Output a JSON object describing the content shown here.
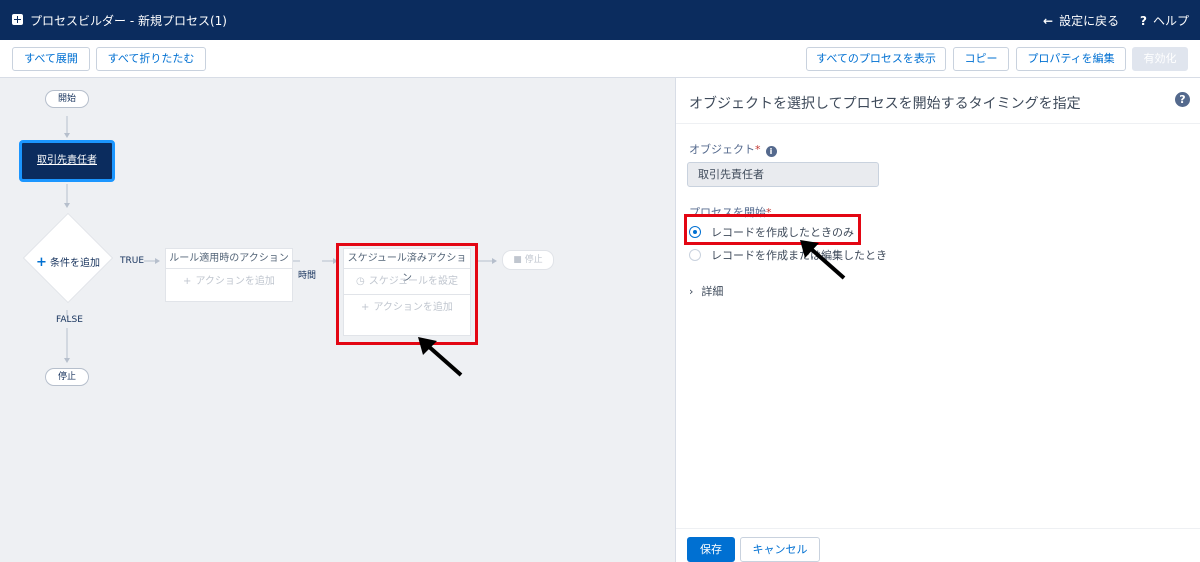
{
  "header": {
    "title": "プロセスビルダー - 新規プロセス(1)",
    "back_label": "設定に戻る",
    "help_label": "ヘルプ",
    "bg_color": "#0b2c5e"
  },
  "toolbar": {
    "expand_all": "すべて展開",
    "collapse_all": "すべて折りたたむ",
    "view_all": "すべてのプロセスを表示",
    "copy": "コピー",
    "edit_properties": "プロパティを編集",
    "activate": "有効化"
  },
  "canvas": {
    "start_label": "開始",
    "object_node": "取引先責任者",
    "criteria_label": "条件を追加",
    "true_label": "TRUE",
    "false_label": "FALSE",
    "stop_label": "停止",
    "immediate": {
      "header": "ルール適用時のアクション",
      "add_action": "アクションを追加"
    },
    "time_label": "時間",
    "scheduled": {
      "header": "スケジュール済みアクション",
      "set_schedule": "スケジュールを設定",
      "add_action": "アクションを追加"
    },
    "stop_label_2": "停止"
  },
  "panel": {
    "title": "オブジェクトを選択してプロセスを開始するタイミングを指定",
    "object_label": "オブジェクト",
    "object_value": "取引先責任者",
    "start_label": "プロセスを開始",
    "options": [
      {
        "label": "レコードを作成したときのみ",
        "selected": true
      },
      {
        "label": "レコードを作成または編集したとき",
        "selected": false
      }
    ],
    "details_label": "詳細",
    "save": "保存",
    "cancel": "キャンセル"
  },
  "annotations": {
    "highlight_color": "#e30613"
  }
}
